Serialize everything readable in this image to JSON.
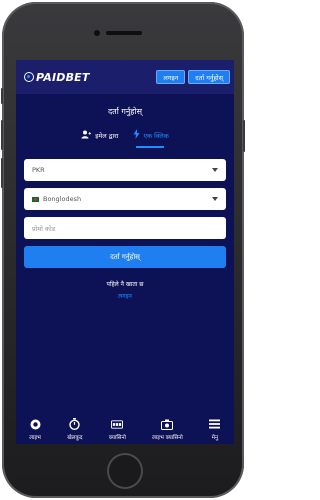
{
  "header": {
    "logo_prefix": "PAID",
    "logo_suffix": "BET",
    "login_button": "लगइन",
    "register_button": "दर्ता गर्नुहोस्"
  },
  "page": {
    "title": "दर्ता गर्नुहोस्"
  },
  "tabs": [
    {
      "label": "इमेल द्वारा",
      "icon": "user-add-icon"
    },
    {
      "label": "एक क्लिक",
      "icon": "lightning-icon"
    }
  ],
  "form": {
    "currency_value": "PKR",
    "country_value": "Bonglodesh",
    "promo_placeholder": "प्रोमो कोड",
    "submit_label": "दर्ता गर्नुहोस्"
  },
  "footer_text": {
    "already_account": "पहिले नै खाता छ",
    "login_link": "लगइन"
  },
  "bottom_nav": [
    {
      "label": "लाइभ",
      "icon": "live-icon"
    },
    {
      "label": "खेलकुद",
      "icon": "stopwatch-icon"
    },
    {
      "label": "क्यासिनो",
      "icon": "casino-icon"
    },
    {
      "label": "लाइभ क्यासिनो",
      "icon": "live-casino-icon"
    },
    {
      "label": "मेनु",
      "icon": "menu-icon"
    }
  ],
  "colors": {
    "screen_bg": "#0d1155",
    "header_bg": "#1a1e6b",
    "accent": "#1f7ef0"
  }
}
